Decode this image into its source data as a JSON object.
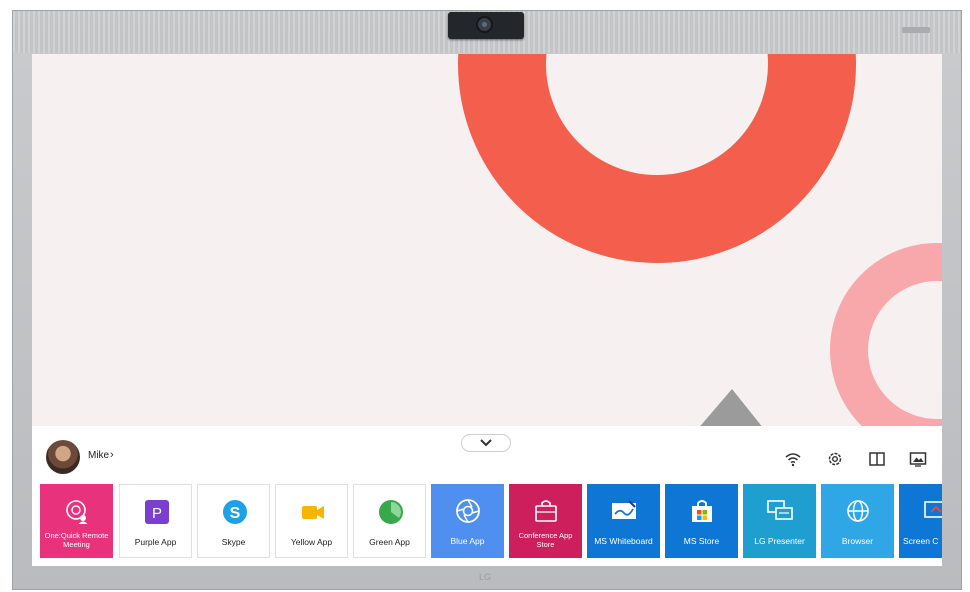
{
  "user": {
    "name": "Mike",
    "chevron": "›"
  },
  "apps": [
    {
      "label": "One:Quick Remote Meeting",
      "icon": "remote-meeting-icon",
      "color": "#e8327c"
    },
    {
      "label": "Purple App",
      "icon": "purple-p-icon",
      "color": "#ffffff"
    },
    {
      "label": "Skype",
      "icon": "skype-icon",
      "color": "#ffffff"
    },
    {
      "label": "Yellow App",
      "icon": "video-camera-icon",
      "color": "#ffffff"
    },
    {
      "label": "Green App",
      "icon": "green-pie-icon",
      "color": "#ffffff"
    },
    {
      "label": "Blue App",
      "icon": "aperture-icon",
      "color": "#4f8ff0"
    },
    {
      "label": "Conference App Store",
      "icon": "shopping-bag-icon",
      "color": "#cc1f5b"
    },
    {
      "label": "MS Whiteboard",
      "icon": "whiteboard-icon",
      "color": "#0e76d4"
    },
    {
      "label": "MS Store",
      "icon": "store-bag-icon",
      "color": "#0e76d4"
    },
    {
      "label": "LG Presenter",
      "icon": "presenter-screens-icon",
      "color": "#1e9fd0"
    },
    {
      "label": "Browser",
      "icon": "globe-icon",
      "color": "#2fa6e5"
    },
    {
      "label": "Screen C",
      "icon": "screen-share-icon",
      "color": "#0e76d4"
    }
  ],
  "brand": "LG",
  "colors": {
    "accent_red": "#f45e4c",
    "accent_pink": "#f8a8ab",
    "screen_bg": "#f6f1f0"
  }
}
